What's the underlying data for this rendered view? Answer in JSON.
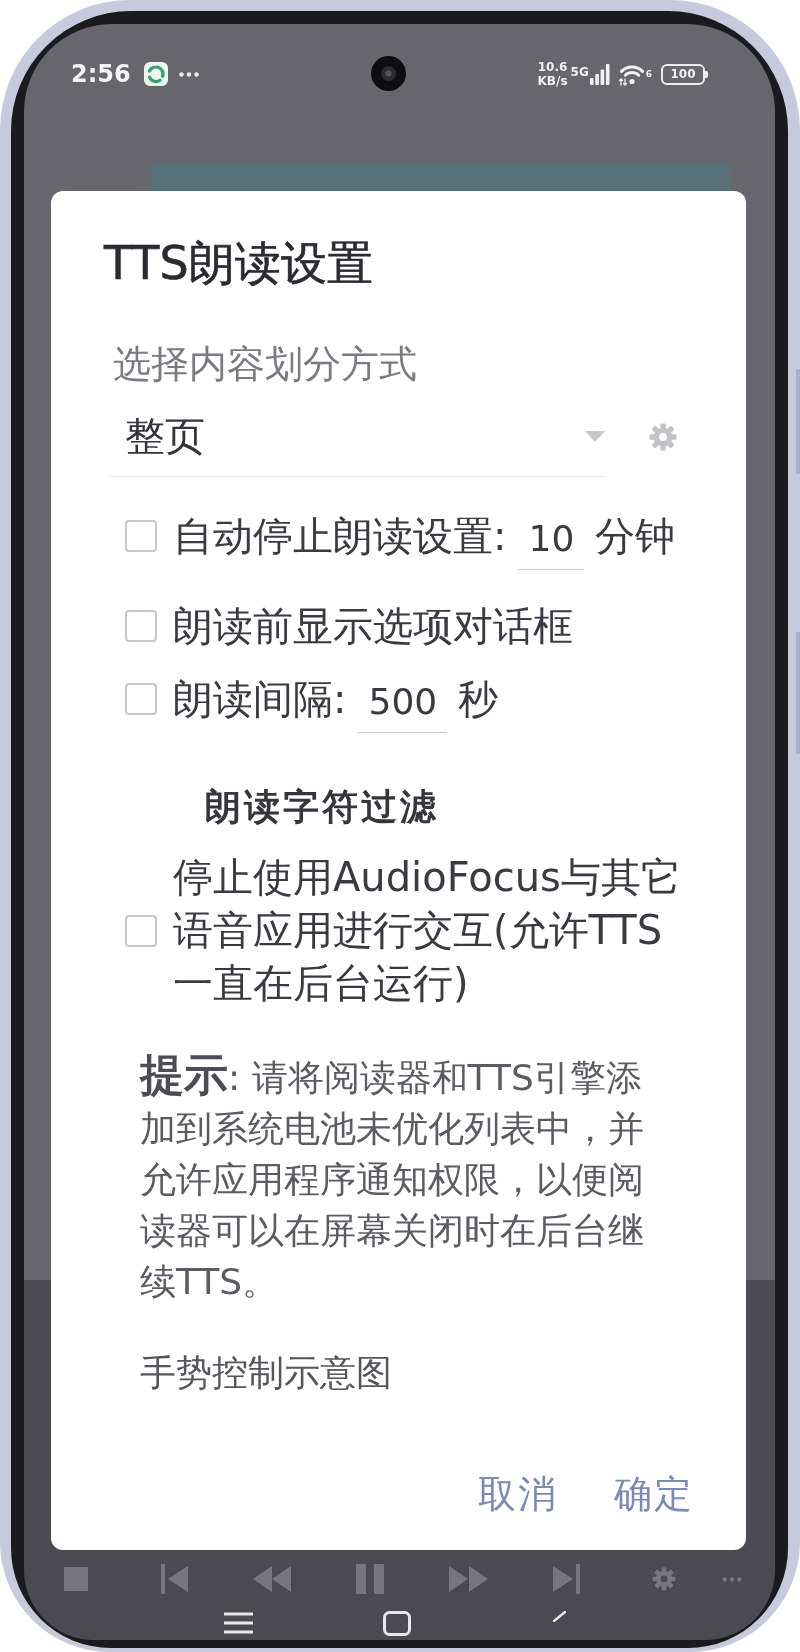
{
  "status_bar": {
    "time": "2:56",
    "net_speed": "10.6",
    "net_speed_unit": "KB/s",
    "network_type": "5G",
    "wifi_standard": "6",
    "battery": "100"
  },
  "dialog": {
    "title": "TTS朗读设置",
    "split_mode": {
      "label": "选择内容划分方式",
      "value": "整页"
    },
    "options": [
      {
        "kind": "timer",
        "checked": false,
        "label": "自动停止朗读设置:",
        "value": "10",
        "unit": "分钟"
      },
      {
        "kind": "plain",
        "checked": false,
        "label": "朗读前显示选项对话框"
      },
      {
        "kind": "timer",
        "checked": false,
        "label": "朗读间隔:",
        "value": "500",
        "unit": "秒"
      }
    ],
    "filter_button": "朗读字符过滤",
    "audio_focus": {
      "checked": false,
      "lines": [
        "停止使用AudioFocus与其它",
        "语音应用进行交互(允许TTS",
        "一直在后台运行)"
      ]
    },
    "hint": {
      "lines": [
        "**提示**: 请将阅读器和TTS引擎添",
        "加到系统电池未优化列表中，并",
        "允许应用程序通知权限，以便阅",
        "读器可以在屏幕关闭时在后台继",
        "续TTS。"
      ]
    },
    "gesture_link": "手势控制示意图",
    "buttons": [
      "取消",
      "确定"
    ]
  }
}
